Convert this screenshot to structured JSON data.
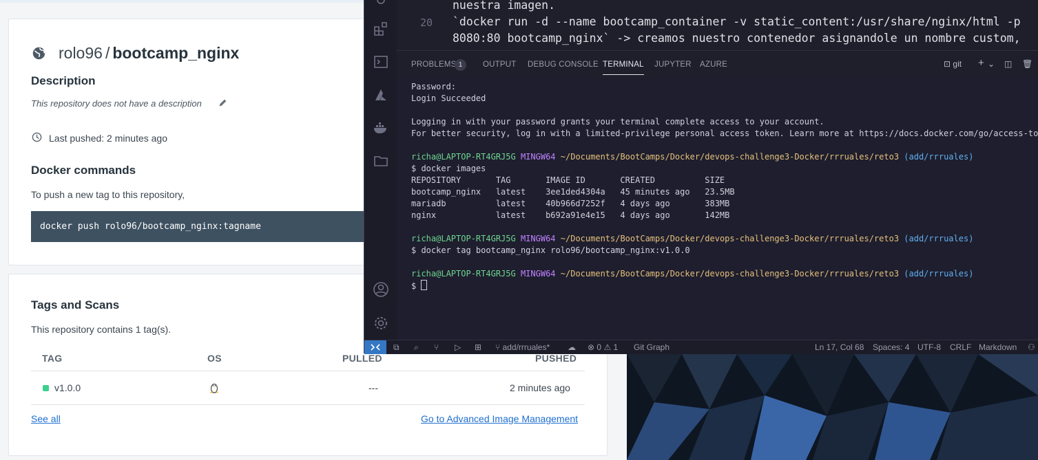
{
  "hub": {
    "namespace": "rolo96",
    "separator": "/",
    "repo_name": "bootcamp_nginx",
    "description_heading": "Description",
    "description_text": "This repository does not have a description",
    "last_pushed": "Last pushed: 2 minutes ago",
    "docker_commands_heading": "Docker commands",
    "push_hint": "To push a new tag to this repository,",
    "push_command": "docker push rolo96/bootcamp_nginx:tagname",
    "tags_heading": "Tags and Scans",
    "tags_count_text": "This repository contains 1 tag(s).",
    "table": {
      "columns": [
        "TAG",
        "OS",
        "PULLED",
        "PUSHED"
      ],
      "rows": [
        {
          "tag": "v1.0.0",
          "pulled": "---",
          "pushed": "2 minutes ago"
        }
      ]
    },
    "see_all": "See all",
    "advanced_link": "Go to Advanced Image Management"
  },
  "vscode": {
    "editor": {
      "line_above": "nuestra imagen.",
      "line_number": "20",
      "line_20a": "`docker run -d --name bootcamp_container -v static_content:/usr/share/nginx/html -p",
      "line_20b": "8080:80 bootcamp_nginx` -> creamos nuestro contenedor asignandole un nombre custom,"
    },
    "panel_tabs": {
      "problems": "PROBLEMS",
      "problems_count": "1",
      "output": "OUTPUT",
      "debug_console": "DEBUG CONSOLE",
      "terminal": "TERMINAL",
      "jupyter": "JUPYTER",
      "azure": "AZURE",
      "shell_label": "git"
    },
    "terminal": {
      "l1": "Password:",
      "l2": "Login Succeeded",
      "l3": "Logging in with your password grants your terminal complete access to your account.",
      "l4": "For better security, log in with a limited-privilege personal access token. Learn more at https://docs.docker.com/go/access-tokens/",
      "prompt_user": "richa@LAPTOP-RT4GRJ5G",
      "prompt_env": "MINGW64",
      "prompt_path": "~/Documents/BootCamps/Docker/devops-challenge3-Docker/rrruales/reto3",
      "prompt_branch": "(add/rrruales)",
      "cmd1": "$ docker images",
      "images_header": "REPOSITORY       TAG       IMAGE ID       CREATED          SIZE",
      "images_row1": "bootcamp_nginx   latest    3ee1ded4304a   45 minutes ago   23.5MB",
      "images_row2": "mariadb          latest    40b966d7252f   4 days ago       383MB",
      "images_row3": "nginx            latest    b692a91e4e15   4 days ago       142MB",
      "cmd2": "$ docker tag bootcamp_nginx rolo96/bootcamp_nginx:v1.0.0",
      "cmd3": "$ "
    },
    "status_bar": {
      "branch": "add/rrruales*",
      "errors": "0",
      "warnings": "1",
      "git_graph": "Git Graph",
      "position": "Ln 17, Col 68",
      "spaces": "Spaces: 4",
      "encoding": "UTF-8",
      "eol": "CRLF",
      "language": "Markdown"
    }
  },
  "colors": {
    "accent_green": "#3ecf8e",
    "link_blue": "#1f6fd1",
    "vscode_remote": "#3477c4"
  }
}
